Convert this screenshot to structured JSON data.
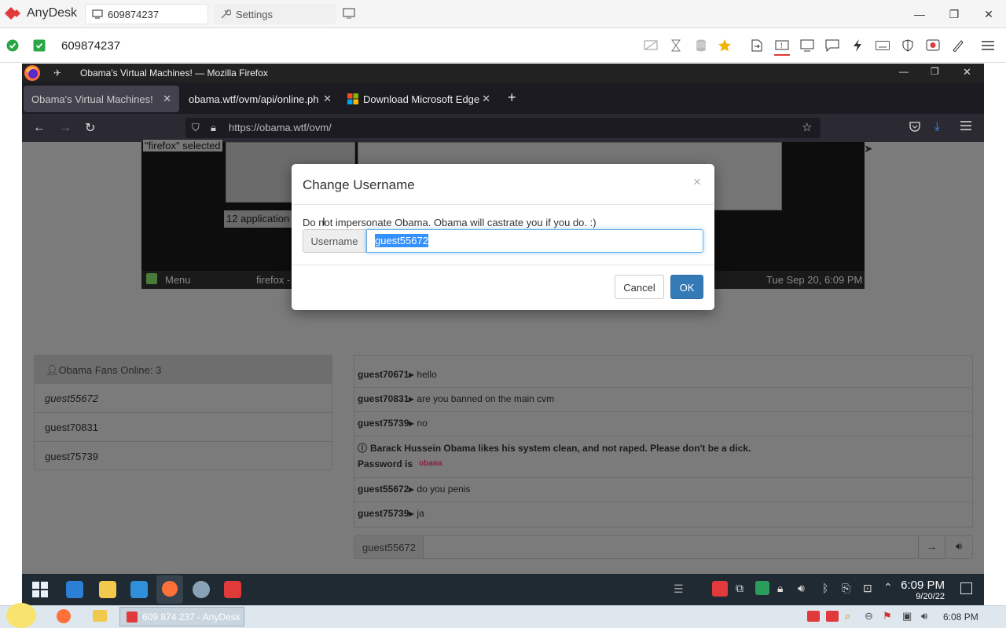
{
  "anydesk": {
    "app_name": "AnyDesk",
    "tab_address": "609874237",
    "tab_settings": "Settings",
    "address": "609874237"
  },
  "firefox": {
    "window_title": "Obama's Virtual Machines! — Mozilla Firefox",
    "tabs": [
      {
        "label": "Obama's Virtual Machines!"
      },
      {
        "label": "obama.wtf/ovm/api/online.ph"
      },
      {
        "label": "Download Microsoft Edge"
      }
    ],
    "url": "https://obama.wtf/ovm/"
  },
  "vm": {
    "selected_text": "\"firefox\" selected",
    "apps_count": "12 application",
    "panel_menu": "Menu",
    "panel_task": "firefox -",
    "panel_clock": "Tue Sep 20,  6:09 PM"
  },
  "online": {
    "header": "Obama Fans Online: 3",
    "users": [
      {
        "name": "guest55672"
      },
      {
        "name": "guest70831"
      },
      {
        "name": "guest75739"
      }
    ]
  },
  "chat": {
    "messages": [
      {
        "user": "guest70671▸",
        "text": "hello"
      },
      {
        "user": "guest70831▸",
        "text": "are you banned on the main cvm"
      },
      {
        "user": "guest75739▸",
        "text": "no"
      },
      {
        "user": "guest55672▸",
        "text": "do you penis"
      },
      {
        "user": "guest75739▸",
        "text": "ja"
      }
    ],
    "notice": "Barack Hussein Obama likes his system clean, and not raped. Please don't be a dick.",
    "password_label": "Password is",
    "password_value": "obama",
    "input_username": "guest55672"
  },
  "modal": {
    "title": "Change Username",
    "close": "×",
    "message": "Do not impersonate Obama. Obama will castrate you if you do. :)",
    "field_label": "Username",
    "field_value": "guest55672",
    "cancel": "Cancel",
    "ok": "OK"
  },
  "remote_taskbar": {
    "time": "6:09 PM",
    "date": "9/20/22"
  },
  "host_taskbar": {
    "task_label": "609 874 237 - AnyDesk",
    "time": "6:08 PM"
  }
}
